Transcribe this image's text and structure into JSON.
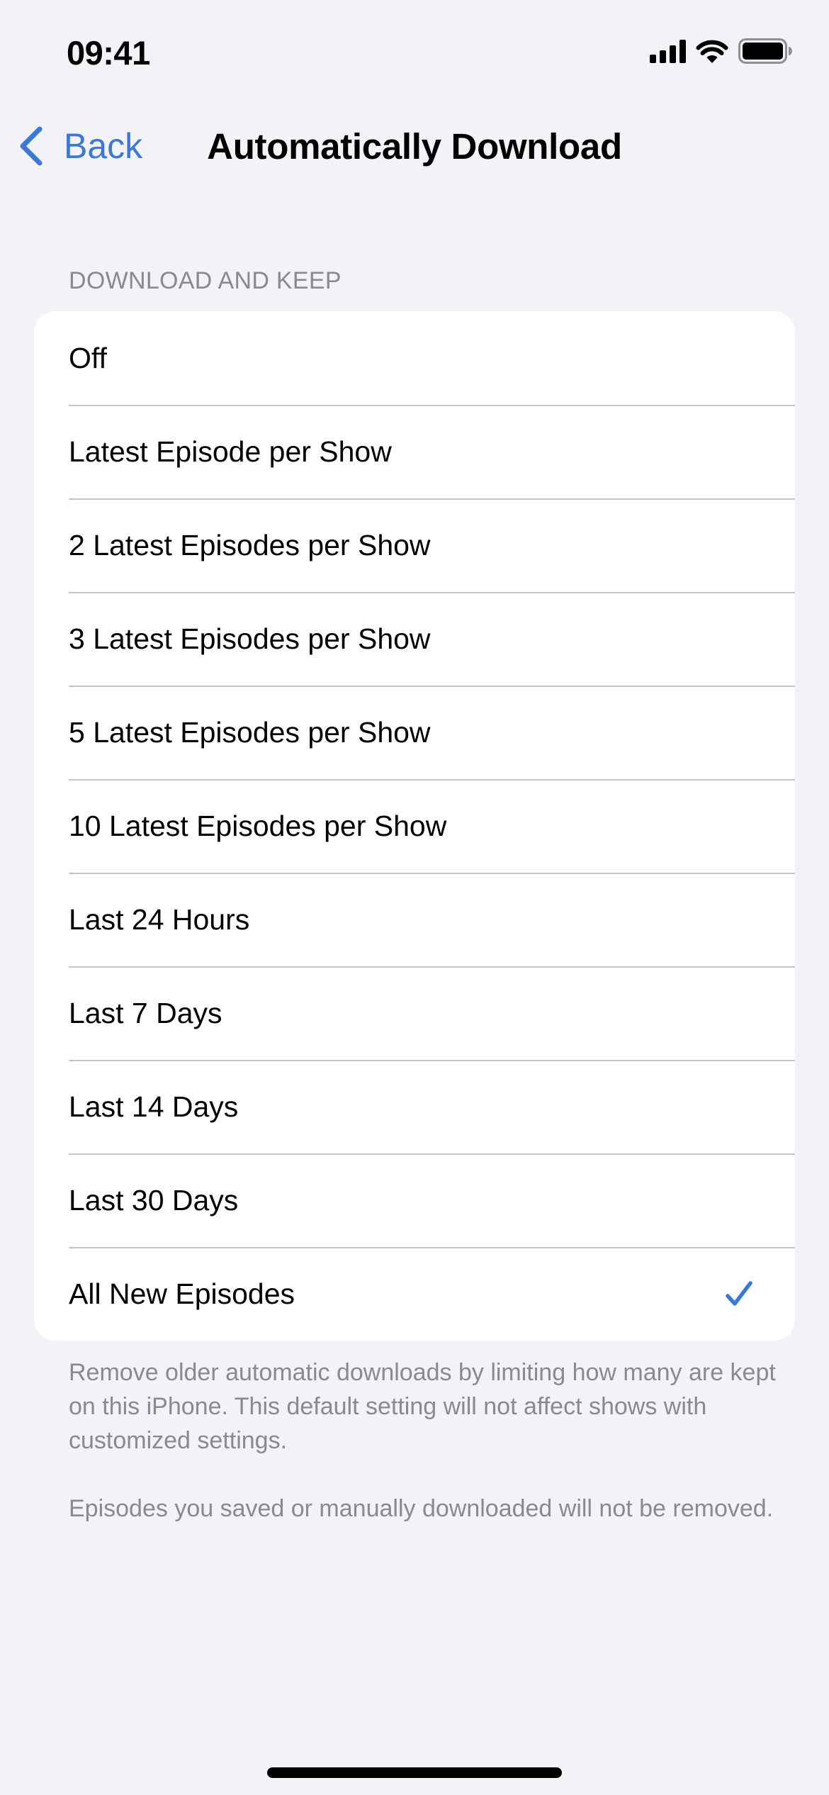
{
  "status_bar": {
    "time": "09:41",
    "icons": [
      "cellular-signal-icon",
      "wifi-icon",
      "battery-icon"
    ]
  },
  "nav": {
    "back_label": "Back",
    "title": "Automatically Download"
  },
  "section": {
    "header": "DOWNLOAD AND KEEP",
    "options": [
      {
        "label": "Off",
        "selected": false
      },
      {
        "label": "Latest Episode per Show",
        "selected": false
      },
      {
        "label": "2 Latest Episodes per Show",
        "selected": false
      },
      {
        "label": "3 Latest Episodes per Show",
        "selected": false
      },
      {
        "label": "5 Latest Episodes per Show",
        "selected": false
      },
      {
        "label": "10 Latest Episodes per Show",
        "selected": false
      },
      {
        "label": "Last 24 Hours",
        "selected": false
      },
      {
        "label": "Last 7 Days",
        "selected": false
      },
      {
        "label": "Last 14 Days",
        "selected": false
      },
      {
        "label": "Last 30 Days",
        "selected": false
      },
      {
        "label": "All New Episodes",
        "selected": true
      }
    ],
    "footer": [
      "Remove older automatic downloads by limiting how many are kept on this iPhone. This default setting will not affect shows with customized settings.",
      "Episodes you saved or manually downloaded will not be removed."
    ]
  },
  "colors": {
    "accent": "#3b78d8",
    "background": "#f2f2f7",
    "card": "#ffffff",
    "secondary_text": "#8a8a8e",
    "separator": "#c6c6c8"
  }
}
